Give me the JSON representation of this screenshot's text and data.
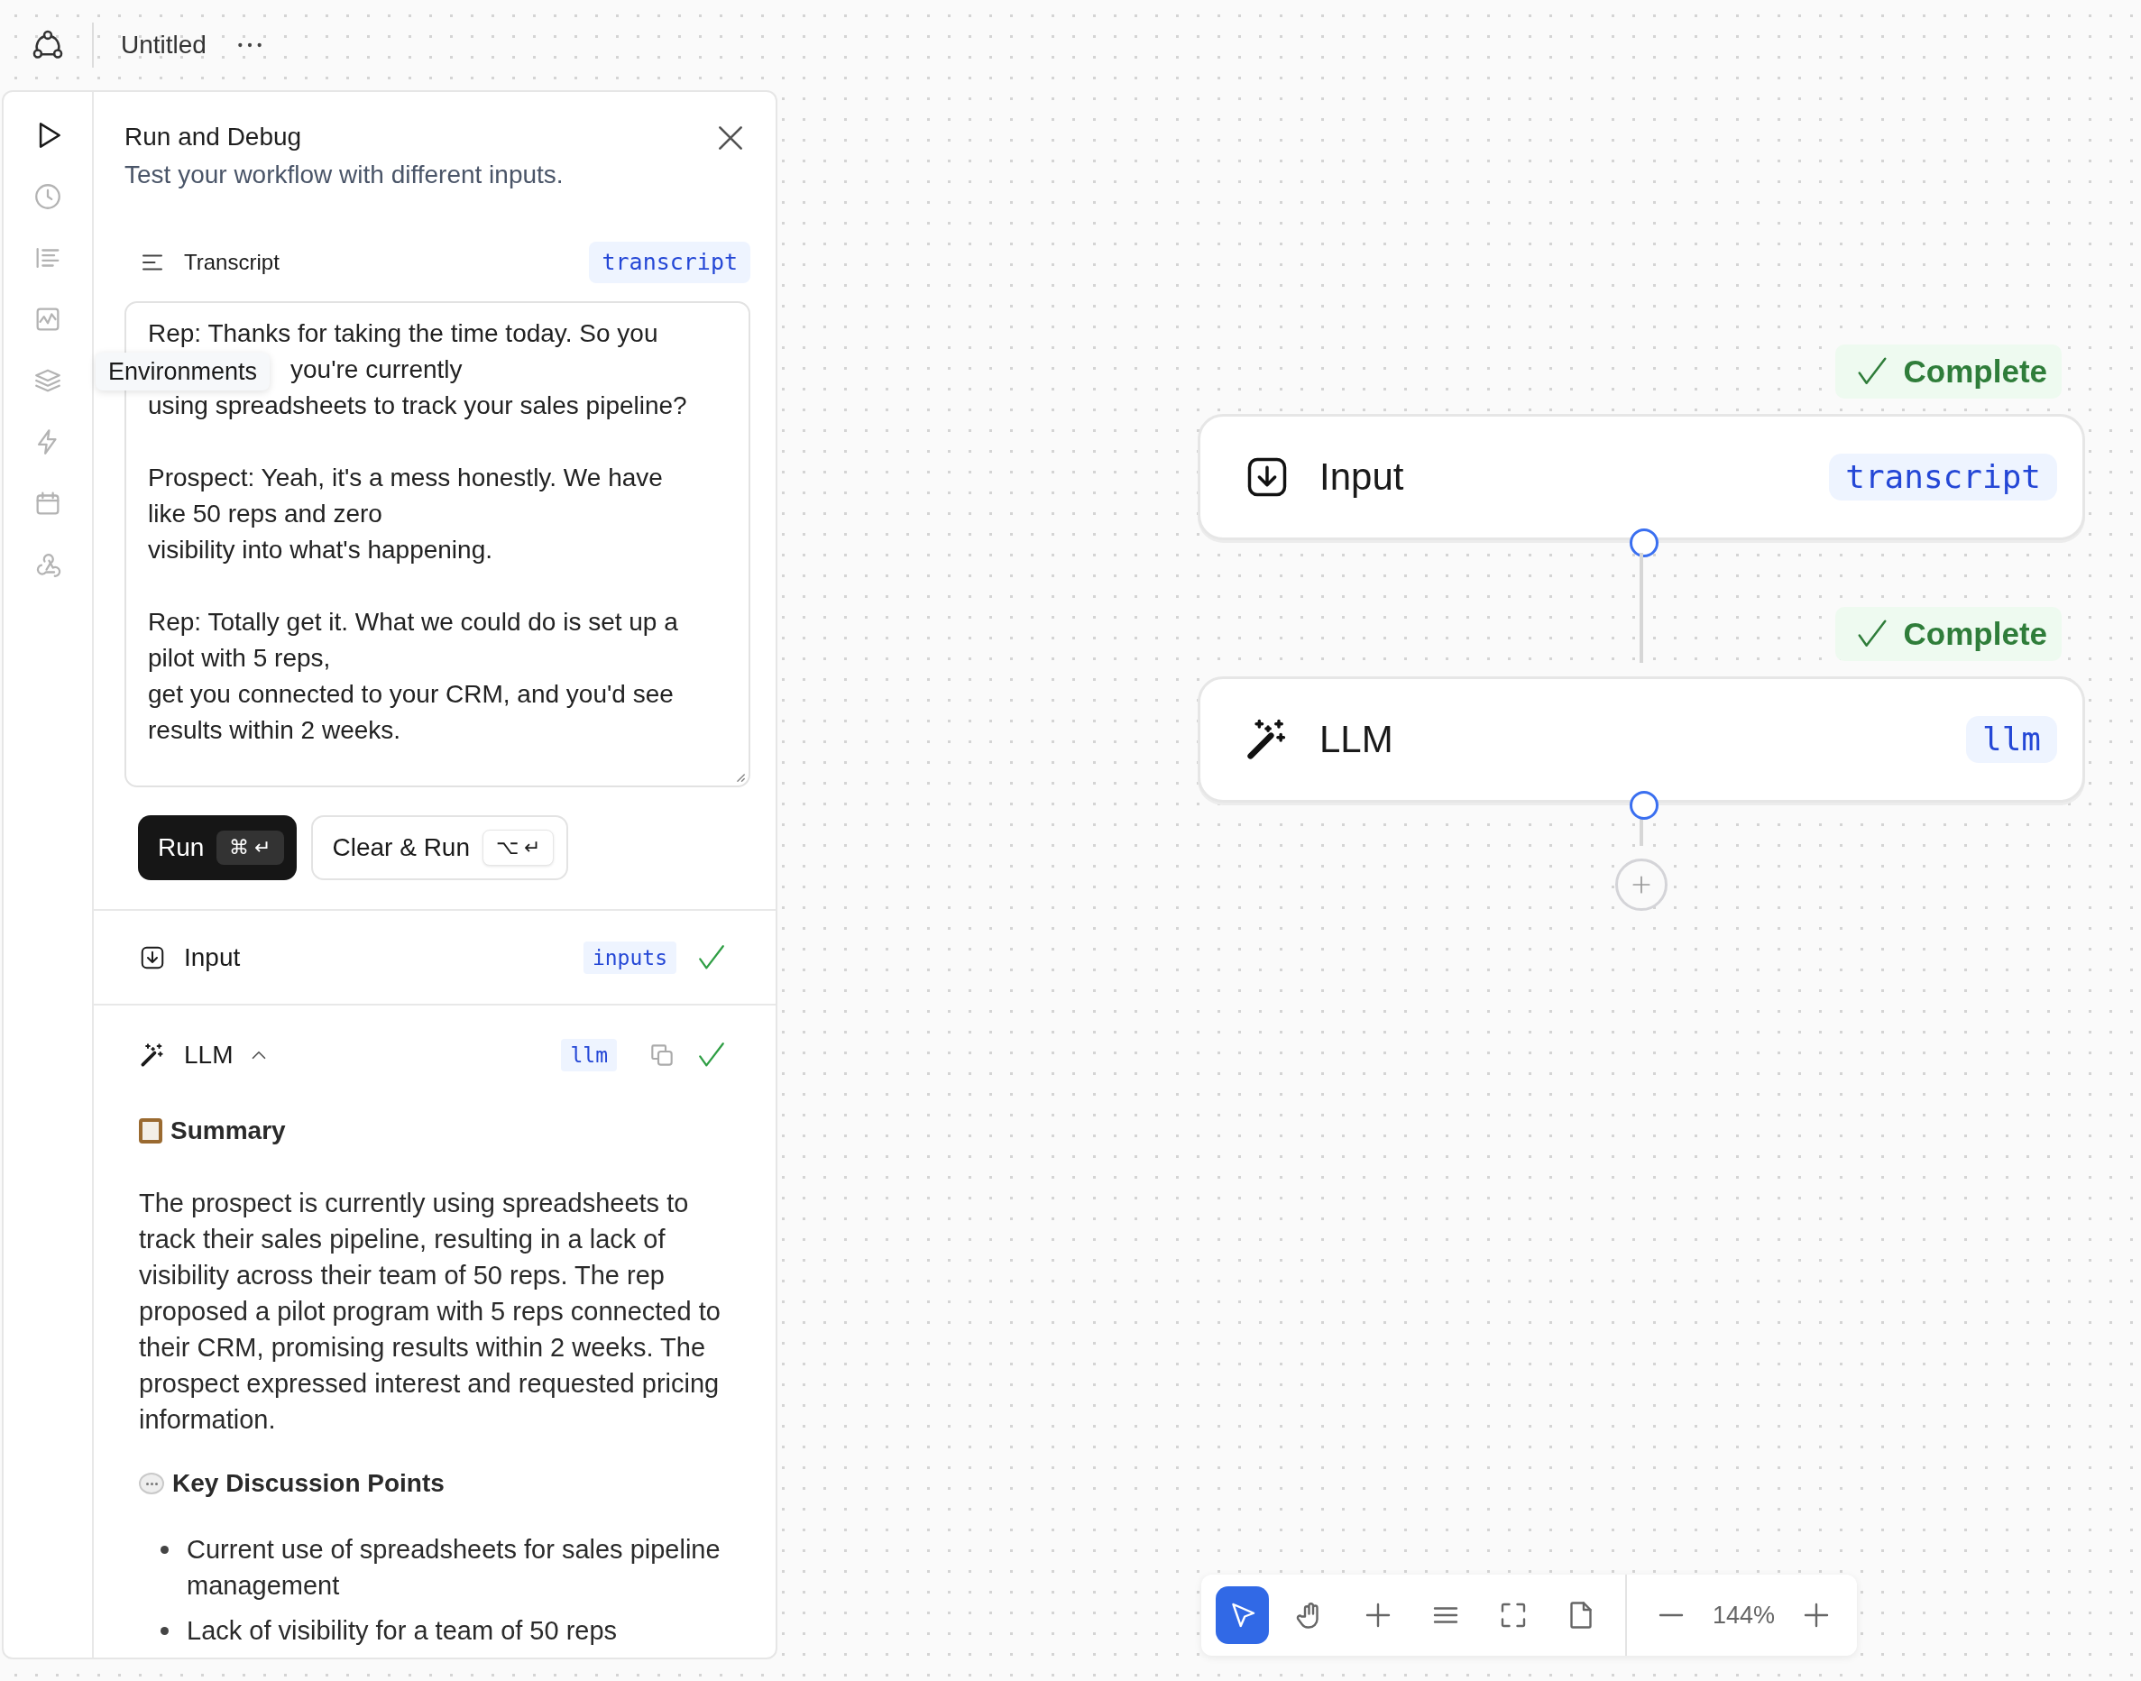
{
  "header": {
    "title": "Untitled"
  },
  "rail": [
    {
      "kind": "play",
      "selected": true
    },
    {
      "kind": "clock",
      "selected": false
    },
    {
      "kind": "list",
      "selected": false
    },
    {
      "kind": "chart",
      "selected": false
    },
    {
      "kind": "layers",
      "selected": false,
      "tooltip": "Environments"
    },
    {
      "kind": "bolt",
      "selected": false
    },
    {
      "kind": "calendar",
      "selected": false
    },
    {
      "kind": "webhook",
      "selected": false
    }
  ],
  "panel": {
    "title": "Run and Debug",
    "subtitle": "Test your workflow with different inputs.",
    "input": {
      "label": "Transcript",
      "badge": "transcript",
      "paragraphs": [
        {
          "lines": [
            "Rep: Thanks for taking the time today. So you",
            "you're currently",
            "using spreadsheets to track your sales pipeline?"
          ]
        },
        {
          "lines": [
            "Prospect: Yeah, it's a mess honestly. We have",
            "like 50 reps and zero",
            "visibility into what's happening."
          ]
        },
        {
          "lines": [
            "Rep: Totally get it. What we could do is set up a",
            "pilot with 5 reps,",
            "get you connected to your CRM, and you'd see",
            "results within 2 weeks."
          ]
        }
      ]
    },
    "buttons": [
      {
        "kind": "primary",
        "label": "Run",
        "keys": [
          "⌘",
          "↵"
        ]
      },
      {
        "kind": "secondary",
        "label": "Clear & Run",
        "keys": [
          "⌥",
          "↵"
        ]
      }
    ],
    "steps": [
      {
        "kind": "input",
        "label": "Input",
        "badge": "inputs",
        "complete": true
      },
      {
        "kind": "llm",
        "label": "LLM",
        "badge": "llm",
        "expanded": true,
        "complete": true,
        "output": [
          {
            "kind": "summary",
            "heading": "Summary",
            "paragraph": "The prospect is currently using spreadsheets to track their sales pipeline, resulting in a lack of visibility across their team of 50 reps. The rep proposed a pilot program with 5 reps connected to their CRM, promising results within 2 weeks. The prospect expressed interest and requested pricing information."
          },
          {
            "kind": "discussion",
            "heading": "Key Discussion Points",
            "bullets": [
              "Current use of spreadsheets for sales pipeline management",
              "Lack of visibility for a team of 50 reps"
            ]
          }
        ]
      }
    ]
  },
  "canvas": {
    "nodes": [
      {
        "kind": "input",
        "label": "Input",
        "badge": "transcript",
        "status": "Complete"
      },
      {
        "kind": "llm",
        "label": "LLM",
        "badge": "llm",
        "status": "Complete"
      }
    ]
  },
  "toolbar": {
    "tools": [
      {
        "kind": "select",
        "selected": true
      },
      {
        "kind": "hand",
        "selected": false
      },
      {
        "kind": "add",
        "selected": false
      },
      {
        "kind": "menu",
        "selected": false
      },
      {
        "kind": "fit",
        "selected": false
      },
      {
        "kind": "page",
        "selected": false
      }
    ],
    "zoom": "144%"
  }
}
